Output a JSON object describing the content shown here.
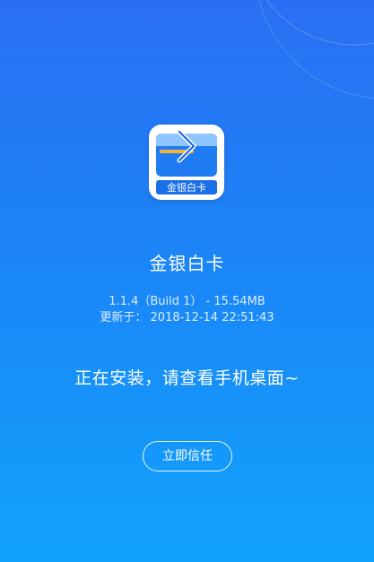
{
  "app": {
    "icon_name": "jinyin-baika-app-icon",
    "icon_label": "金银白卡",
    "name": "金银白卡",
    "version": "1.1.4（Build 1） - 15.54MB",
    "updated": "更新于： 2018-12-14 22:51:43"
  },
  "status": {
    "message": "正在安装，请查看手机桌面~"
  },
  "actions": {
    "trust_label": "立即信任"
  },
  "colors": {
    "bg_top": "#2a6ff3",
    "bg_bottom": "#11a3fb",
    "icon_card_blue": "#1f7cf3",
    "icon_label_bg": "#1a6fe8"
  }
}
